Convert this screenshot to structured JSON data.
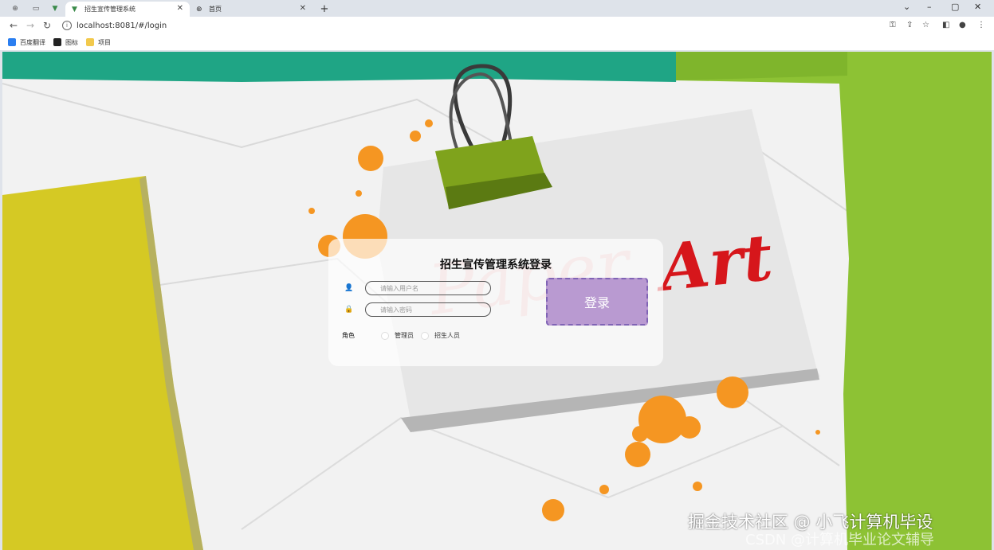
{
  "browser": {
    "tabs": [
      {
        "title": "招生宣传管理系统",
        "active": true
      },
      {
        "title": "首页",
        "active": false
      }
    ],
    "new_tab": "+",
    "url": "localhost:8081/#/login",
    "bookmarks": [
      {
        "label": "百度翻译",
        "color": "#2a7ef0"
      },
      {
        "label": "图标",
        "color": "#222222"
      },
      {
        "label": "项目",
        "color": "#f2c94c"
      }
    ]
  },
  "login": {
    "title": "招生宣传管理系统登录",
    "username_placeholder": "请输入用户名",
    "password_placeholder": "请输入密码",
    "role_label": "角色",
    "roles": [
      "管理员",
      "招生人员"
    ],
    "submit": "登录"
  },
  "background": {
    "art_text": "PaperArt",
    "colors": {
      "teal": "#1fa585",
      "green": "#8dc234",
      "yellow": "#d5c924",
      "orange": "#f59622",
      "red": "#d6161b",
      "button": "#b99ad1"
    }
  },
  "watermark": {
    "line1": "掘金技术社区 @ 小飞计算机毕设",
    "line2": "CSDN @计算机毕业论文辅导"
  }
}
